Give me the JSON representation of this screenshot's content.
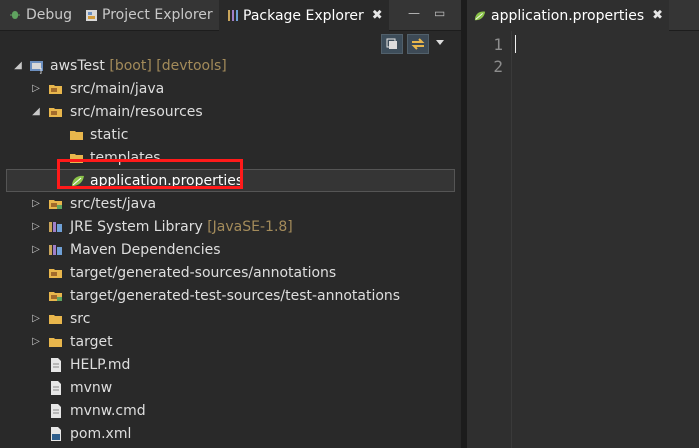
{
  "left_tabs": [
    {
      "label": "Debug",
      "icon": "debug-icon"
    },
    {
      "label": "Project Explorer",
      "icon": "project-explorer-icon"
    },
    {
      "label": "Package Explorer",
      "icon": "package-explorer-icon",
      "active": true
    }
  ],
  "close_glyph": "✖",
  "window": {
    "minimize": "—",
    "maximize": "▭"
  },
  "tree": [
    {
      "label": "awsTest",
      "deco": "[boot] [devtools]",
      "icon": "project-icon",
      "expanded": true
    },
    {
      "label": "src/main/java",
      "icon": "source-folder-icon",
      "expanded": false
    },
    {
      "label": "src/main/resources",
      "icon": "source-folder-icon",
      "expanded": true
    },
    {
      "label": "static",
      "icon": "folder-icon"
    },
    {
      "label": "templates",
      "icon": "folder-icon"
    },
    {
      "label": "application.properties",
      "icon": "spring-leaf-icon",
      "selected": true
    },
    {
      "label": "src/test/java",
      "icon": "source-folder-icon",
      "expanded": false
    },
    {
      "label": "JRE System Library",
      "deco": "[JavaSE-1.8]",
      "icon": "library-icon",
      "expanded": false
    },
    {
      "label": "Maven Dependencies",
      "icon": "library-icon",
      "expanded": false
    },
    {
      "label": "target/generated-sources/annotations",
      "icon": "generated-source-folder-icon"
    },
    {
      "label": "target/generated-test-sources/test-annotations",
      "icon": "generated-source-folder-icon"
    },
    {
      "label": "src",
      "icon": "folder-icon",
      "expanded": false
    },
    {
      "label": "target",
      "icon": "folder-icon",
      "expanded": false
    },
    {
      "label": "HELP.md",
      "icon": "file-icon"
    },
    {
      "label": "mvnw",
      "icon": "file-icon"
    },
    {
      "label": "mvnw.cmd",
      "icon": "file-icon"
    },
    {
      "label": "pom.xml",
      "icon": "maven-file-icon"
    }
  ],
  "editor": {
    "tab_label": "application.properties",
    "line_numbers": [
      "1",
      "2"
    ]
  },
  "colors": {
    "accent_highlight": "#ff1a1a",
    "decoration": "#a38b5a"
  }
}
